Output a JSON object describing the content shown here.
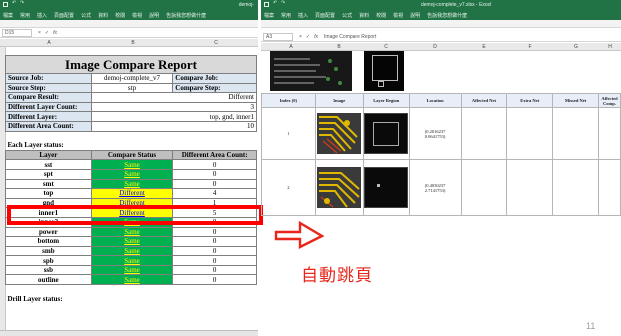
{
  "left_window": {
    "title": "demoj-",
    "menu": [
      "檔案",
      "常用",
      "插入",
      "頁面配置",
      "公式",
      "資料",
      "校閱",
      "檢視",
      "說明",
      "告訴我您想做什麼"
    ],
    "name_box": "D15",
    "col_headers": [
      "A",
      "B",
      "C"
    ]
  },
  "report": {
    "title": "Image Compare Report",
    "source_job_label": "Source Job:",
    "source_job_value": "demoj-complete_v7",
    "compare_job_label": "Compare Job:",
    "source_step_label": "Source Step:",
    "source_step_value": "stp",
    "compare_step_label": "Compare Step:",
    "compare_result_label": "Compare Result:",
    "compare_result_value": "Different",
    "diff_layer_count_label": "Different Layer Count:",
    "diff_layer_count_value": "3",
    "diff_layer_label": "Different Layer:",
    "diff_layer_value": "top, gnd, inner1",
    "diff_area_count_label": "Different Area Count:",
    "diff_area_count_value": "10",
    "each_layer_label": "Each Layer status:",
    "col_layer": "Layer",
    "col_status": "Compare Status",
    "col_count": "Different Area Count:",
    "layers": [
      {
        "name": "sst",
        "status": "Same",
        "count": "0",
        "diff": false
      },
      {
        "name": "spt",
        "status": "Same",
        "count": "0",
        "diff": false
      },
      {
        "name": "smt",
        "status": "Same",
        "count": "0",
        "diff": false
      },
      {
        "name": "top",
        "status": "Different",
        "count": "4",
        "diff": true
      },
      {
        "name": "gnd",
        "status": "Different",
        "count": "1",
        "diff": true
      },
      {
        "name": "inner1",
        "status": "Different",
        "count": "5",
        "diff": true
      },
      {
        "name": "inner2",
        "status": "Same",
        "count": "0",
        "diff": false
      },
      {
        "name": "power",
        "status": "Same",
        "count": "0",
        "diff": false
      },
      {
        "name": "bottom",
        "status": "Same",
        "count": "0",
        "diff": false
      },
      {
        "name": "smb",
        "status": "Same",
        "count": "0",
        "diff": false
      },
      {
        "name": "spb",
        "status": "Same",
        "count": "0",
        "diff": false
      },
      {
        "name": "ssb",
        "status": "Same",
        "count": "0",
        "diff": false
      },
      {
        "name": "outline",
        "status": "Same",
        "count": "0",
        "diff": false
      }
    ],
    "drill_label": "Drill Layer status:"
  },
  "right_window": {
    "title": "demoj-complete_v7.xlsx - Excel",
    "menu": [
      "檔案",
      "常用",
      "插入",
      "頁面配置",
      "公式",
      "資料",
      "校閱",
      "檢視",
      "說明",
      "告訴我您想做什麼"
    ],
    "name_box": "A3",
    "formula": "Image Compare Report",
    "col_headers": [
      "A",
      "B",
      "C",
      "D",
      "E",
      "F",
      "G",
      "H"
    ],
    "table_headers": [
      "Index (0)",
      "Image",
      "Layer Region",
      "Location",
      "Affected Net",
      "Extra Net",
      "Missed Net",
      "Affected Comp."
    ],
    "rows": [
      {
        "index": "1",
        "location": "(0.2016237\n0.0641753)"
      },
      {
        "index": "2",
        "location": "(0.4030237\n2.7141753)"
      }
    ]
  },
  "annotation": {
    "note": "自動跳頁",
    "arrow_color": "#e8261a"
  },
  "page_number": "11",
  "colors": {
    "excel_green": "#217346",
    "same_green": "#00b050",
    "different_yellow": "#ffff00",
    "highlight_red": "#ff0000"
  }
}
